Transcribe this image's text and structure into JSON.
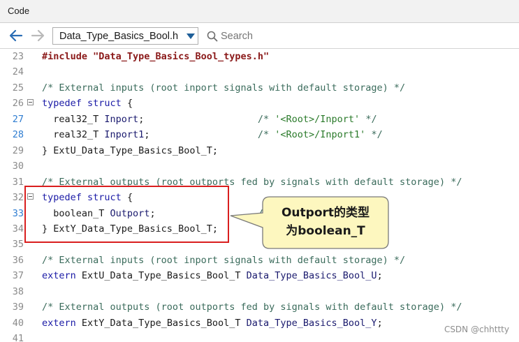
{
  "window": {
    "title": "Code"
  },
  "toolbar": {
    "file_name": "Data_Type_Basics_Bool.h",
    "search_placeholder": "Search"
  },
  "editor": {
    "lines": [
      {
        "num": "23",
        "text": "#include \"Data_Type_Basics_Bool_types.h\""
      },
      {
        "num": "24",
        "text": ""
      },
      {
        "num": "25",
        "text": "/* External inputs (root inport signals with default storage) */"
      },
      {
        "num": "26",
        "text": "typedef struct {"
      },
      {
        "num": "27",
        "text": "  real32_T Inport;                    /* '<Root>/Inport' */"
      },
      {
        "num": "28",
        "text": "  real32_T Inport1;                   /* '<Root>/Inport1' */"
      },
      {
        "num": "29",
        "text": "} ExtU_Data_Type_Basics_Bool_T;"
      },
      {
        "num": "30",
        "text": ""
      },
      {
        "num": "31",
        "text": "/* External outputs (root outports fed by signals with default storage) */"
      },
      {
        "num": "32",
        "text": "typedef struct {"
      },
      {
        "num": "33",
        "text": "  boolean_T Outport;                  /* '<Root>/Outport' */"
      },
      {
        "num": "34",
        "text": "} ExtY_Data_Type_Basics_Bool_T;"
      },
      {
        "num": "35",
        "text": ""
      },
      {
        "num": "36",
        "text": "/* External inputs (root inport signals with default storage) */"
      },
      {
        "num": "37",
        "text": "extern ExtU_Data_Type_Basics_Bool_T Data_Type_Basics_Bool_U;"
      },
      {
        "num": "38",
        "text": ""
      },
      {
        "num": "39",
        "text": "/* External outputs (root outports fed by signals with default storage) */"
      },
      {
        "num": "40",
        "text": "extern ExtY_Data_Type_Basics_Bool_T Data_Type_Basics_Bool_Y;"
      },
      {
        "num": "41",
        "text": ""
      }
    ]
  },
  "annotation": {
    "line1": "Outport的类型",
    "line2": "为boolean_T"
  },
  "watermark": "CSDN @chhttty",
  "colors": {
    "highlight_box": "#d91e1e",
    "callout_fill": "#fdf7bf",
    "callout_border": "#7a7a7a"
  }
}
